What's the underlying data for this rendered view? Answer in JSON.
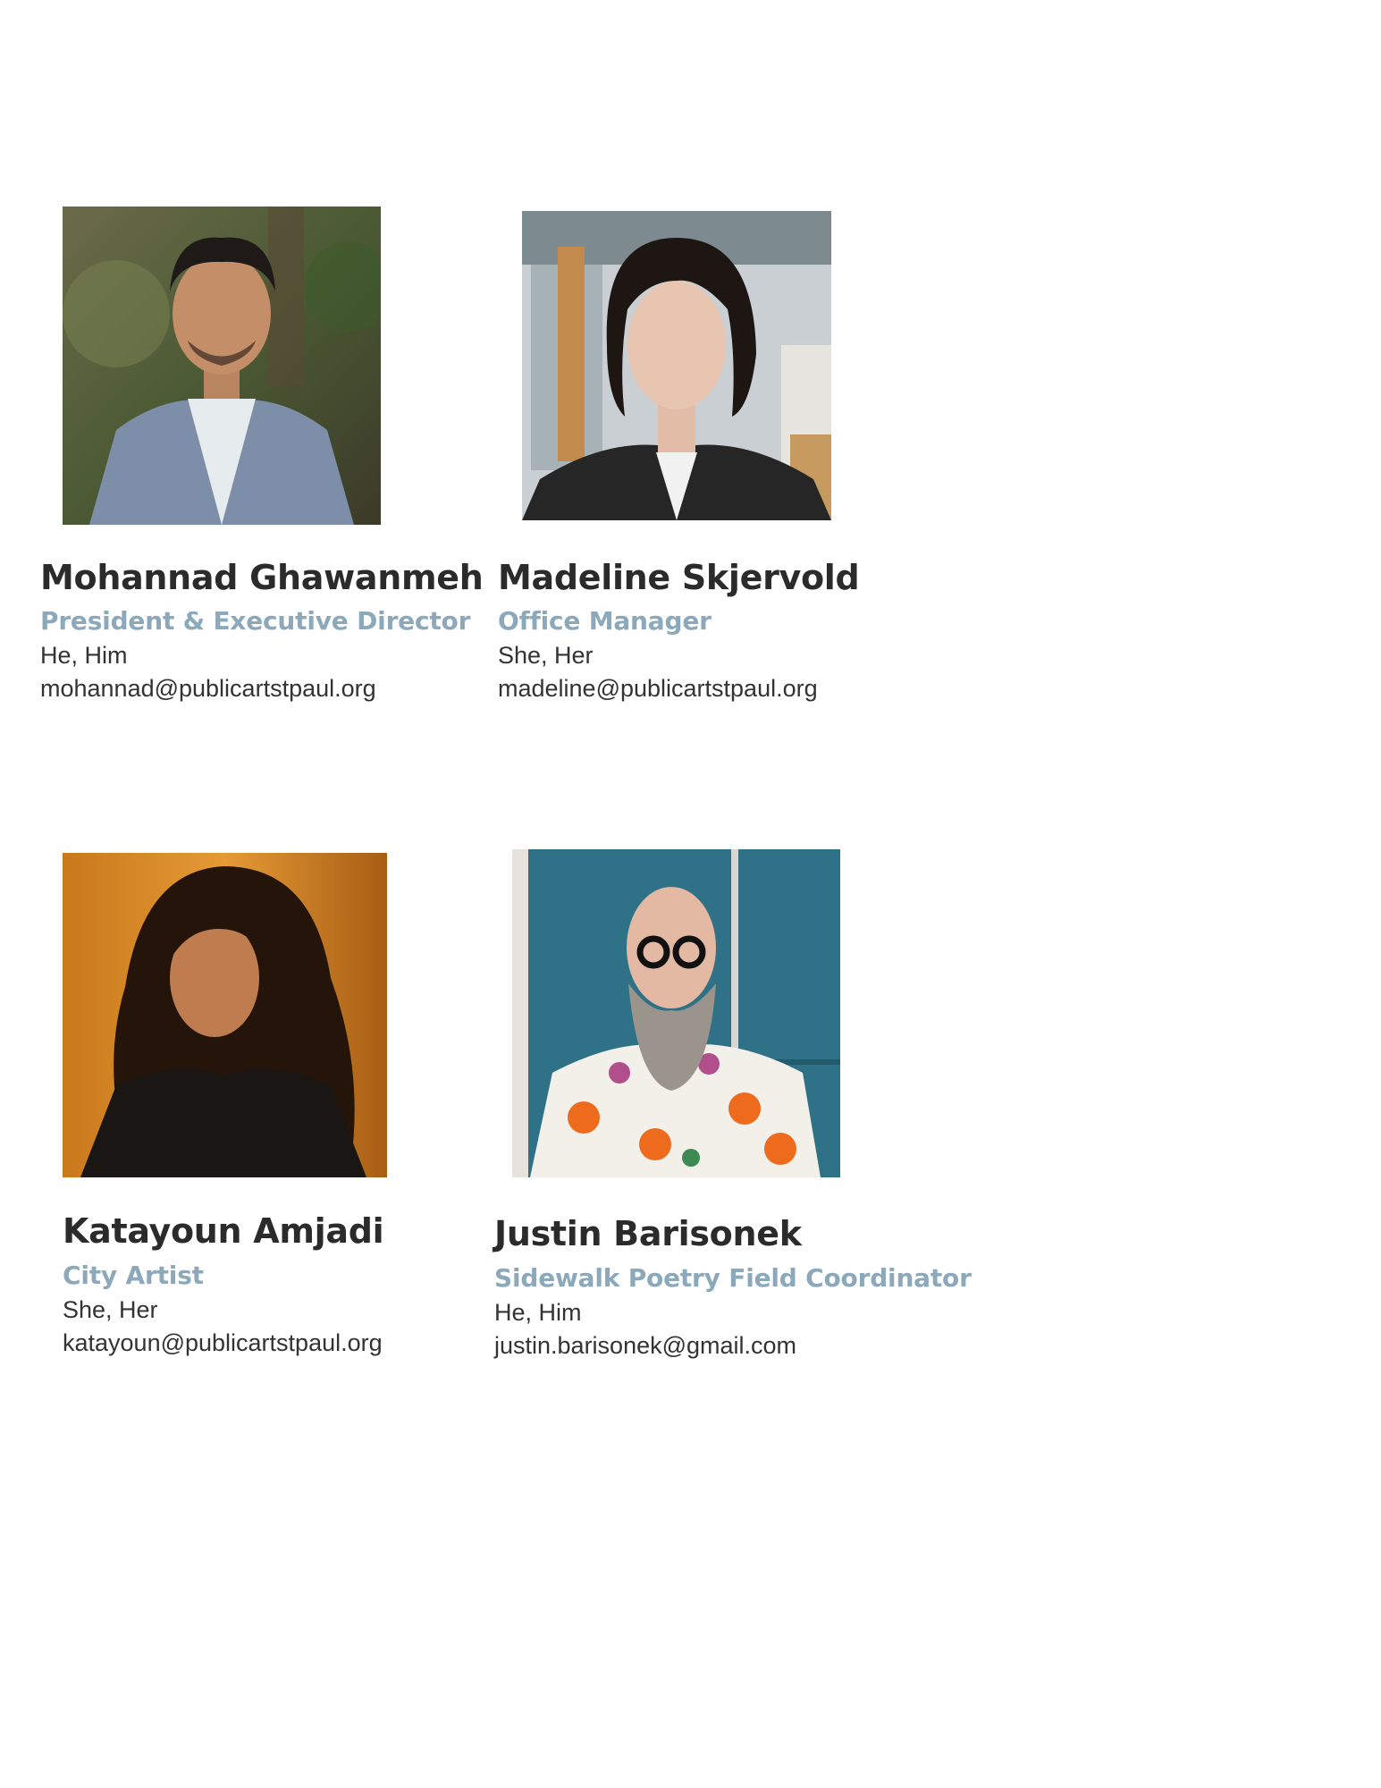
{
  "staff": [
    {
      "name": "Mohannad Ghawanmeh",
      "role": "President & Executive Director",
      "pronouns": "He, Him",
      "email": "mohannad@publicartstpaul.org",
      "photo_icon": "person-portrait-icon"
    },
    {
      "name": "Madeline Skjervold",
      "role": "Office Manager",
      "pronouns": "She, Her",
      "email": "madeline@publicartstpaul.org",
      "photo_icon": "person-portrait-icon"
    },
    {
      "name": "Katayoun Amjadi",
      "role": "City Artist",
      "pronouns": "She, Her",
      "email": "katayoun@publicartstpaul.org",
      "photo_icon": "person-portrait-icon"
    },
    {
      "name": "Justin Barisonek",
      "role": "Sidewalk Poetry Field Coordinator",
      "pronouns": "He, Him",
      "email": "justin.barisonek@gmail.com",
      "photo_icon": "person-portrait-icon"
    }
  ],
  "colors": {
    "name": "#2b2b2b",
    "role": "#8ba9bb",
    "body_text": "#333333"
  }
}
